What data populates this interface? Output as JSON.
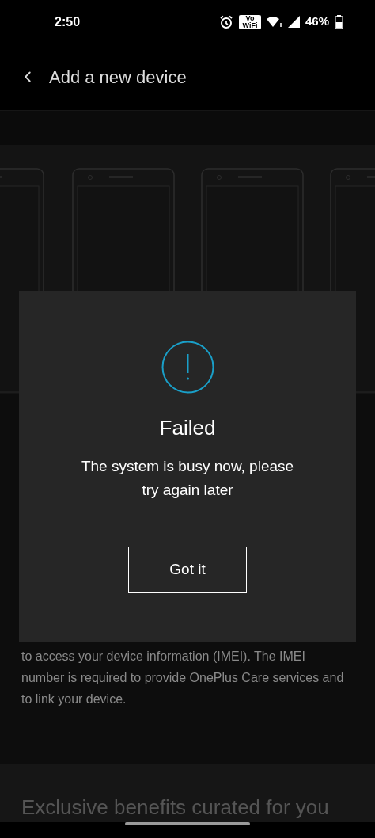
{
  "status_bar": {
    "time": "2:50",
    "vowifi_label": "Vo WiFi",
    "battery": "46%"
  },
  "header": {
    "title": "Add a new device"
  },
  "body": {
    "paragraph": "to access your device information (IMEI). The IMEI number is required to provide OnePlus Care services and to link your device.",
    "section_heading": "Exclusive benefits curated for you"
  },
  "dialog": {
    "title": "Failed",
    "message": "The system is busy now, please try again later",
    "button": "Got it"
  }
}
